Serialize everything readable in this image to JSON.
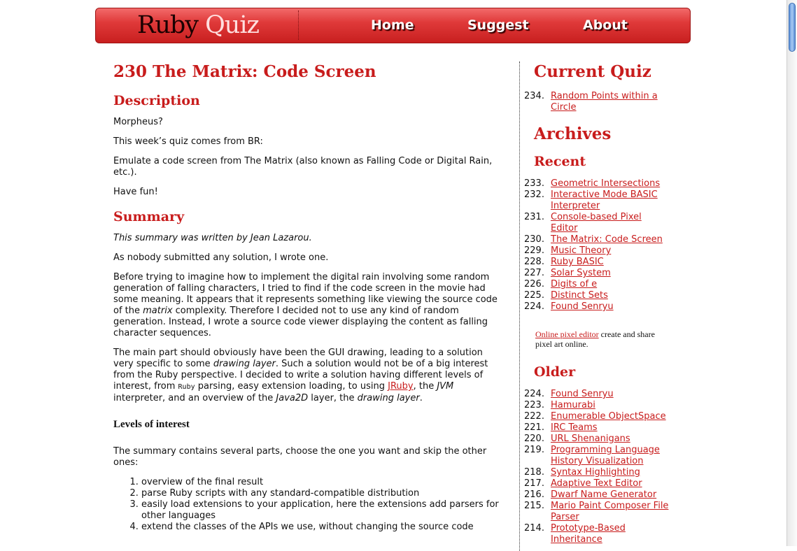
{
  "header": {
    "logo_word1": "Ruby",
    "logo_word2": "Quiz",
    "nav": [
      "Home",
      "Suggest",
      "About"
    ]
  },
  "main": {
    "title": "230 The Matrix: Code Screen",
    "description_heading": "Description",
    "description": [
      "Morpheus?",
      "This week’s quiz comes from BR:",
      "Emulate a code screen from The Matrix (also known as Falling Code or Digital Rain, etc.).",
      "Have fun!"
    ],
    "summary_heading": "Summary",
    "summary_byline": "This summary was written by Jean Lazarou.",
    "summary_p1": "As nobody submitted any solution, I wrote one.",
    "summary_p2_a": "Before trying to imagine how to implement the digital rain involving some random generation of falling characters, I tried to find if the code screen in the movie had some meaning. It appears that it represents something like viewing the source code of the ",
    "summary_p2_em": "matrix",
    "summary_p2_b": " complexity. Therefore I decided not to use any kind of random generation. Instead, I wrote a source code viewer displaying the content as falling character sequences.",
    "summary_p3_a": "The main part should obviously have been the GUI drawing, leading to a solution very specific to some ",
    "summary_p3_em1": "drawing layer",
    "summary_p3_b": ". Such a solution would not be of a big interest from the Ruby perspective. I decided to write a solution having different levels of interest, from ",
    "summary_p3_code": "Ruby",
    "summary_p3_c": " parsing, easy extension loading, to using ",
    "summary_p3_link": "JRuby",
    "summary_p3_d": ", the ",
    "summary_p3_em2": "JVM",
    "summary_p3_e": " interpreter, and an overview of the ",
    "summary_p3_em3": "Java2D",
    "summary_p3_f": " layer, the ",
    "summary_p3_em4": "drawing layer",
    "summary_p3_g": ".",
    "levels_heading": "Levels of interest",
    "levels_intro": "The summary contains several parts, choose the one you want and skip the other ones:",
    "levels": [
      "overview of the final result",
      "parse Ruby scripts with any standard-compatible distribution",
      "easily load extensions to your application, here the extensions add parsers for other languages",
      "extend the classes of the APIs we use, without changing the source code"
    ]
  },
  "sidebar": {
    "current_heading": "Current Quiz",
    "current": [
      {
        "num": "234.",
        "title": "Random Points within a Circle"
      }
    ],
    "archives_heading": "Archives",
    "recent_heading": "Recent",
    "recent": [
      {
        "num": "233.",
        "title": "Geometric Intersections"
      },
      {
        "num": "232.",
        "title": "Interactive Mode BASIC Interpreter"
      },
      {
        "num": "231.",
        "title": "Console-based Pixel Editor"
      },
      {
        "num": "230.",
        "title": "The Matrix: Code Screen"
      },
      {
        "num": "229.",
        "title": "Music Theory"
      },
      {
        "num": "228.",
        "title": "Ruby BASIC"
      },
      {
        "num": "227.",
        "title": "Solar System"
      },
      {
        "num": "226.",
        "title": "Digits of e"
      },
      {
        "num": "225.",
        "title": "Distinct Sets"
      },
      {
        "num": "224.",
        "title": "Found Senryu"
      }
    ],
    "promo_link": "Online pixel editor",
    "promo_text": " create and share pixel art online.",
    "older_heading": "Older",
    "older": [
      {
        "num": "224.",
        "title": "Found Senryu"
      },
      {
        "num": "223.",
        "title": "Hamurabi"
      },
      {
        "num": "222.",
        "title": "Enumerable ObjectSpace"
      },
      {
        "num": "221.",
        "title": "IRC Teams"
      },
      {
        "num": "220.",
        "title": "URL Shenanigans"
      },
      {
        "num": "219.",
        "title": "Programming Language History Visualization"
      },
      {
        "num": "218.",
        "title": "Syntax Highlighting"
      },
      {
        "num": "217.",
        "title": "Adaptive Text Editor"
      },
      {
        "num": "216.",
        "title": "Dwarf Name Generator"
      },
      {
        "num": "215.",
        "title": "Mario Paint Composer File Parser"
      },
      {
        "num": "214.",
        "title": "Prototype-Based Inheritance"
      }
    ]
  }
}
